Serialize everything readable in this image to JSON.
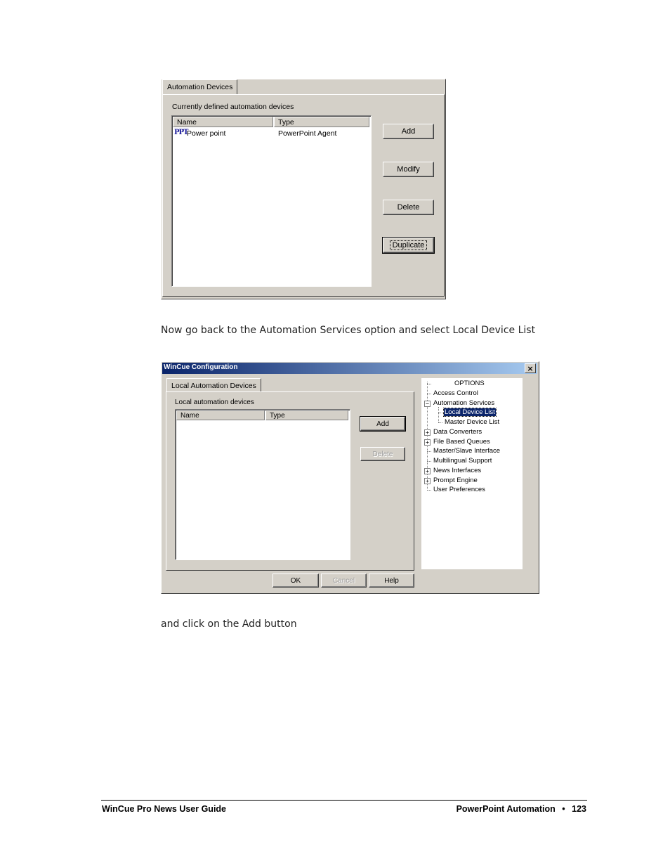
{
  "dialog1": {
    "tab_label": "Automation Devices",
    "group_label": "Currently defined automation devices",
    "columns": [
      "Name",
      "Type"
    ],
    "rows": [
      {
        "icon_text": "PPT",
        "name": "Power point",
        "type": "PowerPoint Agent"
      }
    ],
    "buttons": {
      "add": "Add",
      "modify": "Modify",
      "delete": "Delete",
      "duplicate": "Duplicate"
    }
  },
  "instruction_1": "Now go back to the Automation Services option and select Local Device List",
  "dialog2": {
    "title": "WinCue Configuration",
    "close_glyph": "×",
    "tab_label": "Local Automation Devices",
    "group_label": "Local automation devices",
    "columns": [
      "Name",
      "Type"
    ],
    "buttons": {
      "add": "Add",
      "delete": "Delete",
      "ok": "OK",
      "cancel": "Cancel",
      "help": "Help"
    },
    "tree": {
      "root": "OPTIONS",
      "items": [
        {
          "label": "Access Control",
          "expander": ""
        },
        {
          "label": "Automation Services",
          "expander": "−"
        },
        {
          "label": "Local Device List",
          "expander": "",
          "selected": true
        },
        {
          "label": "Master Device List",
          "expander": ""
        },
        {
          "label": "Data Converters",
          "expander": "+"
        },
        {
          "label": "File Based Queues",
          "expander": "+"
        },
        {
          "label": "Master/Slave Interface",
          "expander": ""
        },
        {
          "label": "Multilingual Support",
          "expander": ""
        },
        {
          "label": "News Interfaces",
          "expander": "+"
        },
        {
          "label": "Prompt Engine",
          "expander": "+"
        },
        {
          "label": "User Preferences",
          "expander": ""
        }
      ]
    }
  },
  "instruction_2": "and click on the Add button",
  "footer": {
    "left": "WinCue Pro News User Guide",
    "section": "PowerPoint Automation",
    "bullet": "•",
    "page": "123"
  },
  "colors": {
    "dialog_bg": "#d4d0c8",
    "title_bar_start": "#0a246a",
    "title_bar_end": "#a6caf0",
    "selection": "#0a246a"
  }
}
